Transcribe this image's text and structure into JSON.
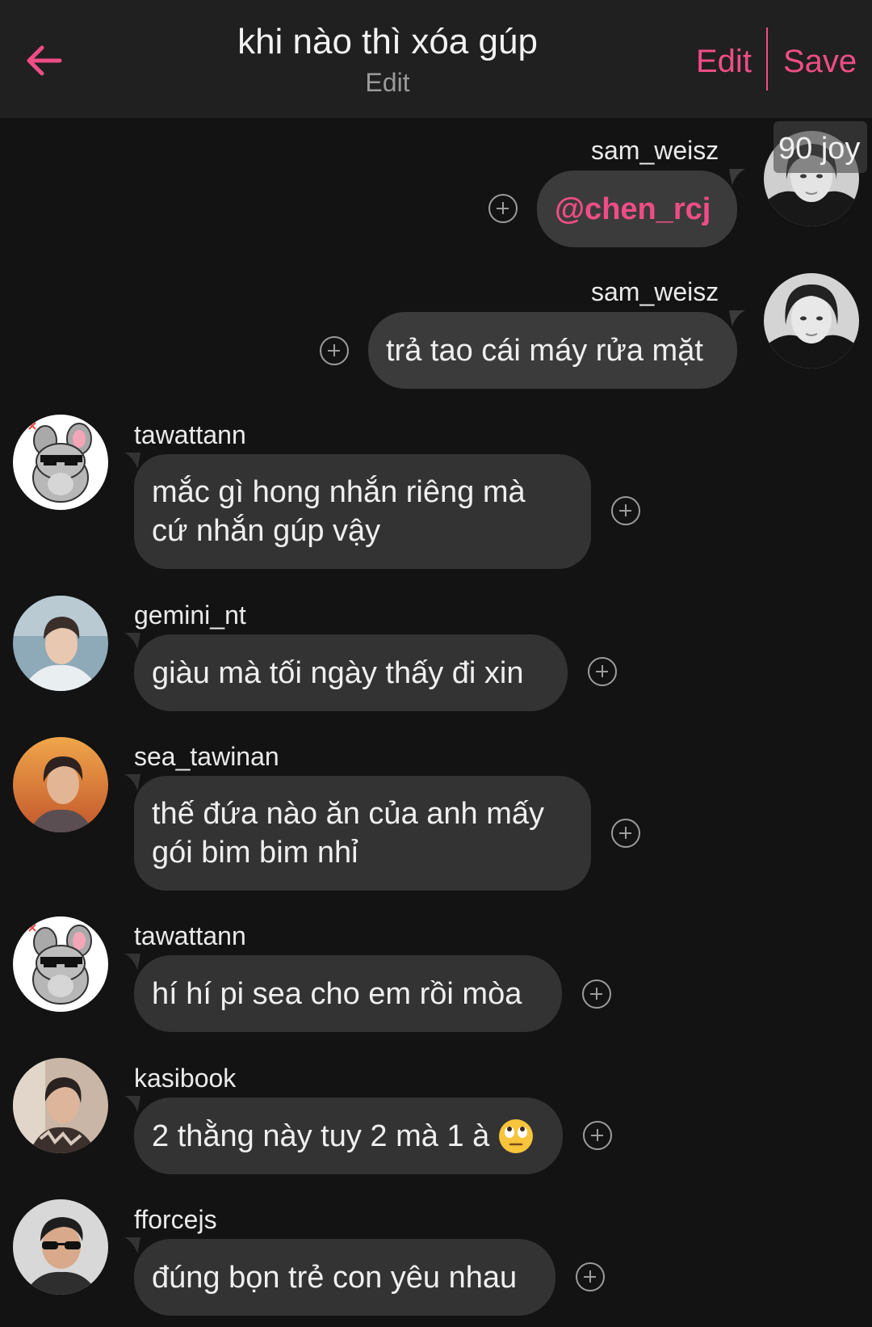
{
  "header": {
    "title": "khi nào thì xóa gúp",
    "subtitle": "Edit",
    "edit_label": "Edit",
    "save_label": "Save"
  },
  "avatar_tag": "90 joy",
  "messages": [
    {
      "user": "sam_weisz",
      "text": "@chen_rcj"
    },
    {
      "user": "sam_weisz",
      "text": "trả tao cái máy rửa mặt"
    },
    {
      "user": "tawattann",
      "text": "mắc gì hong nhắn riêng mà\ncứ nhắn gúp vậy"
    },
    {
      "user": "gemini_nt",
      "text": "giàu mà tối ngày thấy đi xin"
    },
    {
      "user": "sea_tawinan",
      "text": "thế đứa nào ăn của anh mấy\ngói bim bim nhỉ"
    },
    {
      "user": "tawattann",
      "text": "hí hí pi sea cho em rồi mòa"
    },
    {
      "user": "kasibook",
      "text": "2 thằng này tuy 2 mà 1 à",
      "emoji": "face-with-rolling-eyes-icon"
    },
    {
      "user": "fforcejs",
      "text": "đúng bọn trẻ con yêu nhau"
    }
  ],
  "colors": {
    "accent": "#ef4d86",
    "background": "#131313",
    "header_background": "#202020",
    "bubble": "#333333"
  }
}
